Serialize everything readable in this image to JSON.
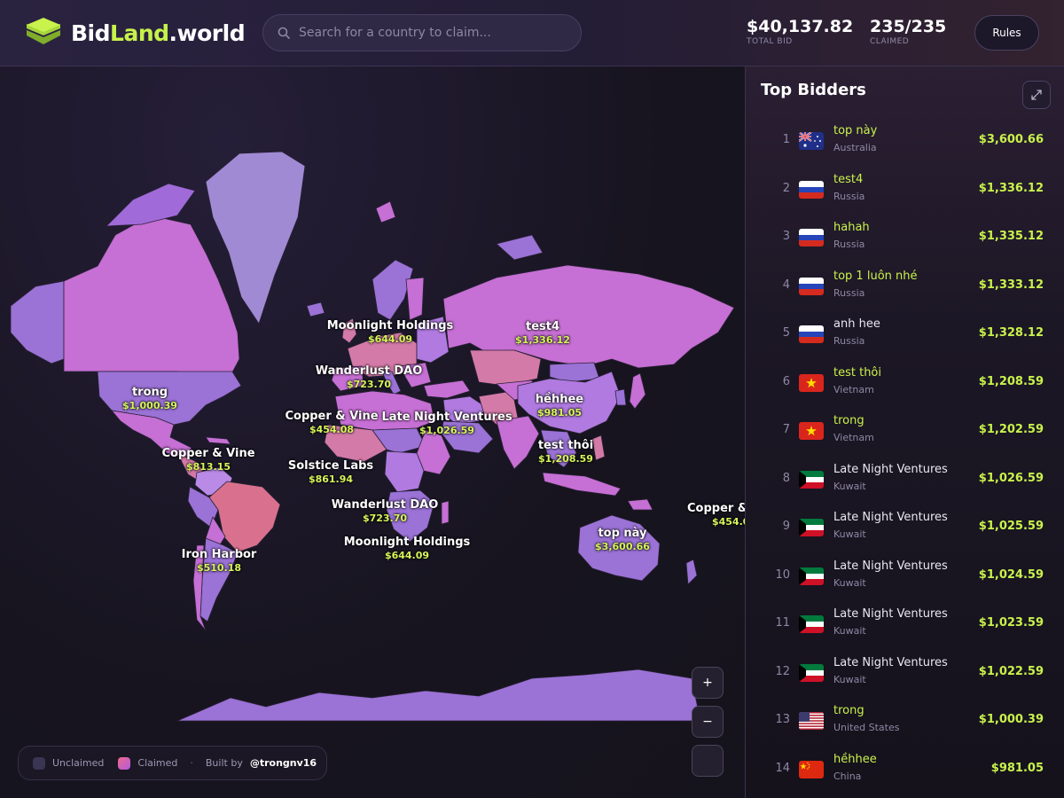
{
  "header": {
    "logo_parts": [
      "Bid",
      "Land",
      ".world"
    ],
    "search_placeholder": "Search for a country to claim...",
    "total_bid_value": "$40,137.82",
    "total_bid_label": "TOTAL BID",
    "claimed_value": "235/235",
    "claimed_label": "CLAIMED",
    "rules_label": "Rules"
  },
  "map": {
    "labels": [
      {
        "name": "Moonlight Holdings",
        "amount": "$644.09"
      },
      {
        "name": "test4",
        "amount": "$1,336.12"
      },
      {
        "name": "Wanderlust DAO",
        "amount": "$723.70"
      },
      {
        "name": "trong",
        "amount": "$1,000.39"
      },
      {
        "name": "hềhhee",
        "amount": "$981.05"
      },
      {
        "name": "Copper & Vine",
        "amount": "$454.08"
      },
      {
        "name": "Late Night Ventures",
        "amount": "$1,026.59"
      },
      {
        "name": "test thôi",
        "amount": "$1,208.59"
      },
      {
        "name": "Copper & Vine",
        "amount": "$813.15"
      },
      {
        "name": "Solstice Labs",
        "amount": "$861.94"
      },
      {
        "name": "Wanderlust DAO",
        "amount": "$723.70"
      },
      {
        "name": "Copper &",
        "amount": "$454.0"
      },
      {
        "name": "top này",
        "amount": "$3,600.66"
      },
      {
        "name": "Moonlight Holdings",
        "amount": "$644.09"
      },
      {
        "name": "Iron Harbor",
        "amount": "$510.18"
      }
    ],
    "zoom_in": "+",
    "zoom_out": "−"
  },
  "legend": {
    "unclaimed": "Unclaimed",
    "claimed": "Claimed",
    "separator": "·",
    "built_by": "Built by",
    "handle": "@trongnv16"
  },
  "sidebar": {
    "title": "Top Bidders",
    "bidders": [
      {
        "rank": "1",
        "name": "top này",
        "country": "Australia",
        "amount": "$3,600.66",
        "flag": "australia"
      },
      {
        "rank": "2",
        "name": "test4",
        "country": "Russia",
        "amount": "$1,336.12",
        "flag": "russia"
      },
      {
        "rank": "3",
        "name": "hahah",
        "country": "Russia",
        "amount": "$1,335.12",
        "flag": "russia"
      },
      {
        "rank": "4",
        "name": "top 1 luôn nhé",
        "country": "Russia",
        "amount": "$1,333.12",
        "flag": "russia"
      },
      {
        "rank": "5",
        "name": "anh hee",
        "country": "Russia",
        "amount": "$1,328.12",
        "flag": "russia"
      },
      {
        "rank": "6",
        "name": "test thôi",
        "country": "Vietnam",
        "amount": "$1,208.59",
        "flag": "vietnam"
      },
      {
        "rank": "7",
        "name": "trong",
        "country": "Vietnam",
        "amount": "$1,202.59",
        "flag": "vietnam"
      },
      {
        "rank": "8",
        "name": "Late Night Ventures",
        "country": "Kuwait",
        "amount": "$1,026.59",
        "flag": "kuwait"
      },
      {
        "rank": "9",
        "name": "Late Night Ventures",
        "country": "Kuwait",
        "amount": "$1,025.59",
        "flag": "kuwait"
      },
      {
        "rank": "10",
        "name": "Late Night Ventures",
        "country": "Kuwait",
        "amount": "$1,024.59",
        "flag": "kuwait"
      },
      {
        "rank": "11",
        "name": "Late Night Ventures",
        "country": "Kuwait",
        "amount": "$1,023.59",
        "flag": "kuwait"
      },
      {
        "rank": "12",
        "name": "Late Night Ventures",
        "country": "Kuwait",
        "amount": "$1,022.59",
        "flag": "kuwait"
      },
      {
        "rank": "13",
        "name": "trong",
        "country": "United States",
        "amount": "$1,000.39",
        "flag": "usa"
      },
      {
        "rank": "14",
        "name": "hềhhee",
        "country": "China",
        "amount": "$981.05",
        "flag": "china"
      }
    ]
  },
  "colors": {
    "accent_green": "#c9f24c",
    "claimed_pink": "#d47aa8",
    "claimed_purple": "#9a6fd8",
    "claimed_magenta": "#c86bd6"
  }
}
